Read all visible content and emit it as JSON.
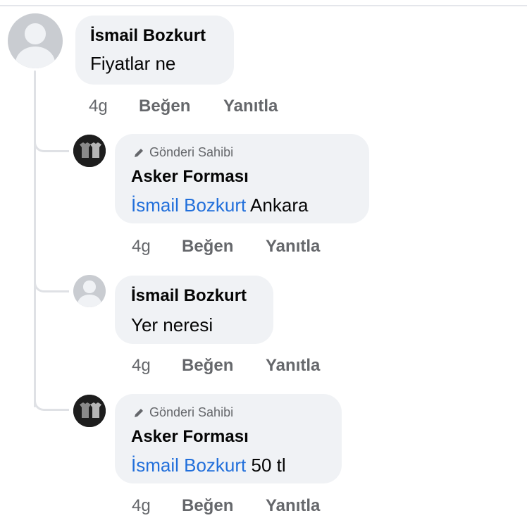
{
  "comments": [
    {
      "author": "İsmail Bozkurt",
      "text": "Fiyatlar ne",
      "time": "4g",
      "like_label": "Beğen",
      "reply_label": "Yanıtla"
    },
    {
      "badge": "Gönderi Sahibi",
      "author": "Asker Forması",
      "mention": "İsmail Bozkurt",
      "text": " Ankara",
      "time": "4g",
      "like_label": "Beğen",
      "reply_label": "Yanıtla"
    },
    {
      "author": "İsmail Bozkurt",
      "text": "Yer neresi",
      "time": "4g",
      "like_label": "Beğen",
      "reply_label": "Yanıtla"
    },
    {
      "badge": "Gönderi Sahibi",
      "author": "Asker Forması",
      "mention": "İsmail Bozkurt",
      "text": " 50 tl",
      "time": "4g",
      "like_label": "Beğen",
      "reply_label": "Yanıtla"
    }
  ],
  "icons": {
    "default_avatar": "default-profile-icon",
    "page_avatar": "jersey-logo-icon",
    "badge": "pencil-icon"
  },
  "colors": {
    "bubble": "#f0f2f5",
    "mention": "#216fdb",
    "meta": "#65676b",
    "thread_line": "#dfe1e5"
  }
}
